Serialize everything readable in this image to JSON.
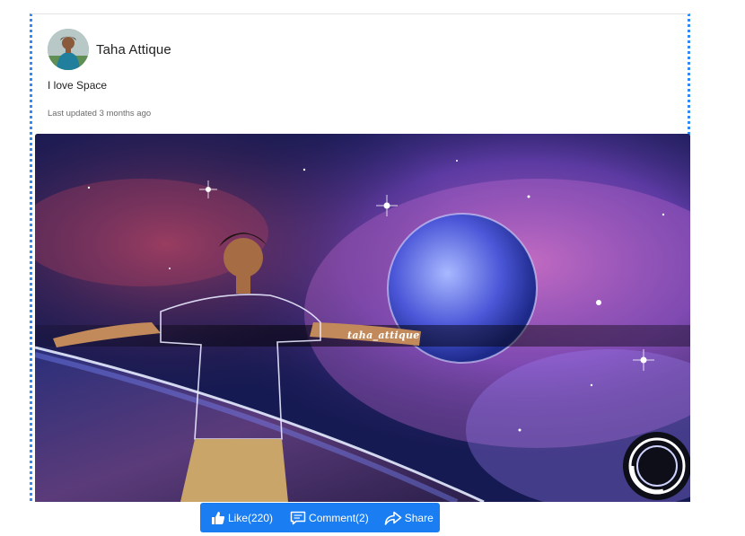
{
  "post": {
    "author_name": "Taha Attique",
    "text": "I love Space",
    "meta": "Last updated 3 months ago",
    "image_watermark": "taha_attique",
    "avatar_icon": "person-avatar",
    "image_subject": "space-scene"
  },
  "actions": {
    "like_label": "Like(220)",
    "comment_label": "Comment(2)",
    "share_label": "Share",
    "like_icon": "thumbs-up-icon",
    "comment_icon": "comment-icon",
    "share_icon": "share-arrow-icon"
  },
  "colors": {
    "accent": "#1a7ef2",
    "card_border": "#2f8cf5"
  }
}
